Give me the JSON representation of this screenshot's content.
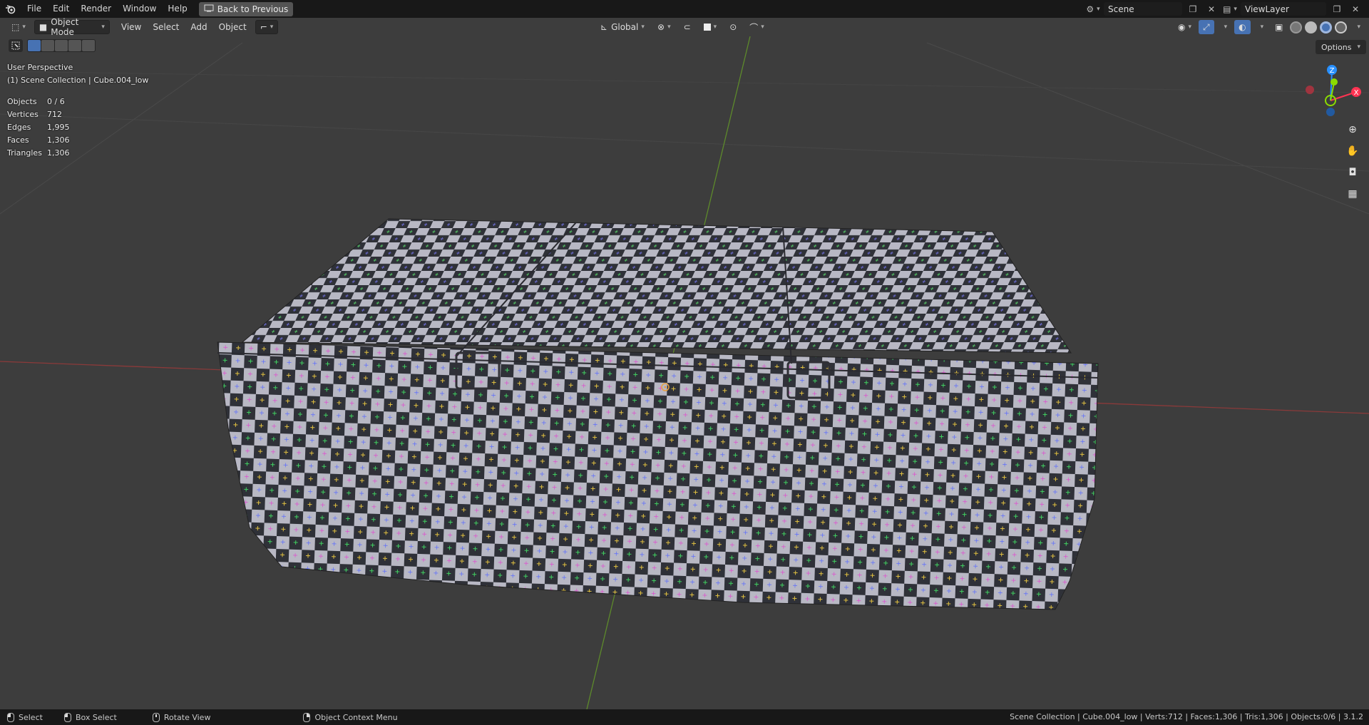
{
  "menu": {
    "items": [
      "File",
      "Edit",
      "Render",
      "Window",
      "Help"
    ],
    "back_label": "Back to Previous"
  },
  "top_right": {
    "scene_name": "Scene",
    "view_layer": "ViewLayer"
  },
  "viewport_header": {
    "mode": "Object Mode",
    "menus": [
      "View",
      "Select",
      "Add",
      "Object"
    ],
    "transform_orientation": "Global",
    "options_label": "Options"
  },
  "overlay": {
    "perspective": "User Perspective",
    "collection": "(1) Scene Collection | Cube.004_low"
  },
  "stats": [
    {
      "label": "Objects",
      "value": "0 / 6"
    },
    {
      "label": "Vertices",
      "value": "712"
    },
    {
      "label": "Edges",
      "value": "1,995"
    },
    {
      "label": "Faces",
      "value": "1,306"
    },
    {
      "label": "Triangles",
      "value": "1,306"
    }
  ],
  "gizmo": {
    "axes": [
      "Z",
      "X",
      "Y"
    ],
    "colors": {
      "x": "#ff3352",
      "y": "#8bdc00",
      "z": "#2890ff"
    }
  },
  "statusbar": {
    "hints": [
      "Select",
      "Box Select",
      "Rotate View",
      "Object Context Menu"
    ],
    "right_text": "Scene Collection | Cube.004_low | Verts:712 | Faces:1,306 | Tris:1,306 | Objects:0/6 | 3.1.2"
  },
  "colors": {
    "viewport_bg": "#3d3d3d",
    "header_bg": "#181818",
    "checker_light": "#b8b8c4",
    "checker_dark": "#2f3138"
  }
}
